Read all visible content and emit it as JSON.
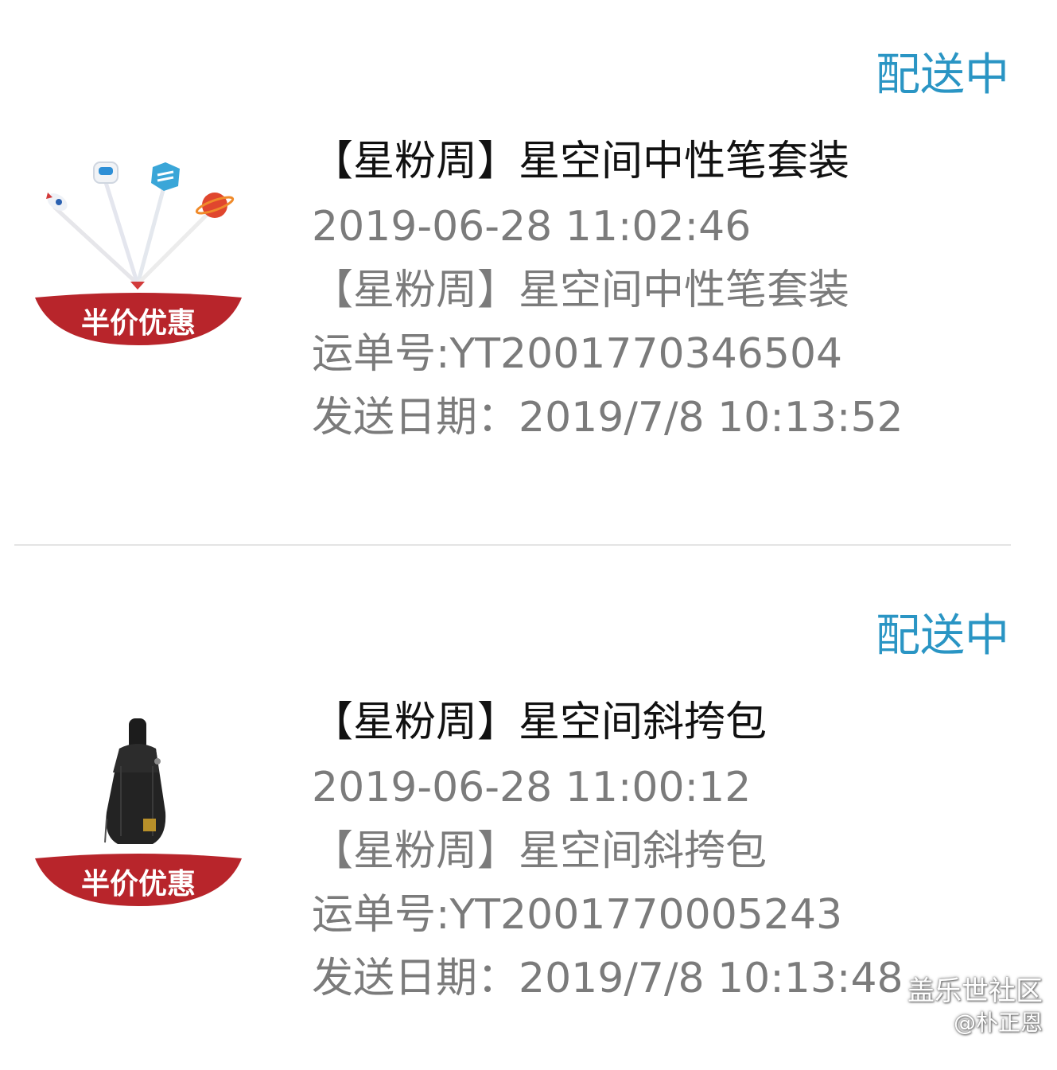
{
  "orders": [
    {
      "status": "配送中",
      "title": "【星粉周】星空间中性笔套装",
      "order_time": "2019-06-28 11:02:46",
      "item_name": "【星粉周】星空间中性笔套装",
      "tracking": "运单号:YT2001770346504",
      "send_date": "发送日期：2019/7/8 10:13:52",
      "badge": "半价优惠",
      "image_icon": "pen-set-icon"
    },
    {
      "status": "配送中",
      "title": "【星粉周】星空间斜挎包",
      "order_time": "2019-06-28 11:00:12",
      "item_name": "【星粉周】星空间斜挎包",
      "tracking": "运单号:YT2001770005243",
      "send_date": "发送日期：2019/7/8 10:13:48",
      "badge": "半价优惠",
      "image_icon": "sling-bag-icon"
    }
  ],
  "watermark": {
    "brand": "盖乐世社区",
    "user": "@朴正恩"
  },
  "colors": {
    "status": "#2a95c4",
    "badge": "#b8252b",
    "title": "#111111",
    "meta": "#7b7b7b"
  }
}
